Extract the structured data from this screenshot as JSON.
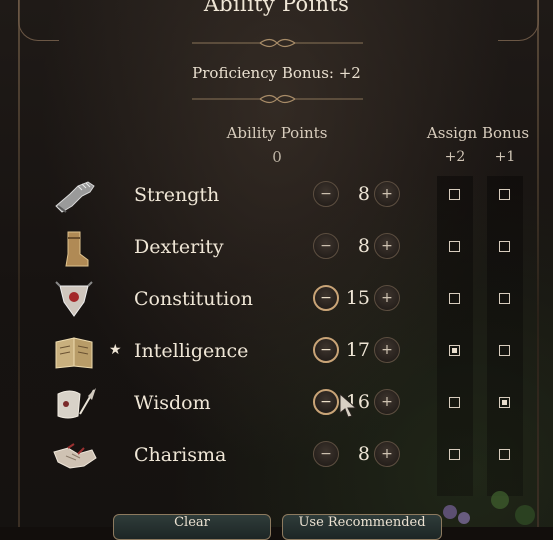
{
  "title": "Ability Points",
  "proficiency": "Proficiency Bonus: +2",
  "ability_points": {
    "label": "Ability Points",
    "remaining": "0"
  },
  "assign_bonus": {
    "label": "Assign Bonus",
    "plus2": "+2",
    "plus1": "+1"
  },
  "abilities": [
    {
      "name": "Strength",
      "score": "8",
      "icon": "gauntlet-icon",
      "starred": false,
      "bonus2": false,
      "bonus1": false,
      "minus_active": false
    },
    {
      "name": "Dexterity",
      "score": "8",
      "icon": "boot-icon",
      "starred": false,
      "bonus2": false,
      "bonus1": false,
      "minus_active": false
    },
    {
      "name": "Constitution",
      "score": "15",
      "icon": "shield-icon",
      "starred": false,
      "bonus2": false,
      "bonus1": false,
      "minus_active": true
    },
    {
      "name": "Intelligence",
      "score": "17",
      "icon": "book-icon",
      "starred": true,
      "star": "★",
      "bonus2": true,
      "bonus1": false,
      "minus_active": true
    },
    {
      "name": "Wisdom",
      "score": "16",
      "icon": "quill-icon",
      "starred": false,
      "bonus2": false,
      "bonus1": true,
      "minus_active": true
    },
    {
      "name": "Charisma",
      "score": "8",
      "icon": "handshake-icon",
      "starred": false,
      "bonus2": false,
      "bonus1": false,
      "minus_active": false
    }
  ],
  "buttons": {
    "clear": "Clear",
    "recommended": "Use Recommended"
  },
  "glyphs": {
    "minus": "−",
    "plus": "+"
  },
  "colors": {
    "accent": "#c9a477",
    "text": "#efe6d6",
    "background": "#1a1512"
  }
}
